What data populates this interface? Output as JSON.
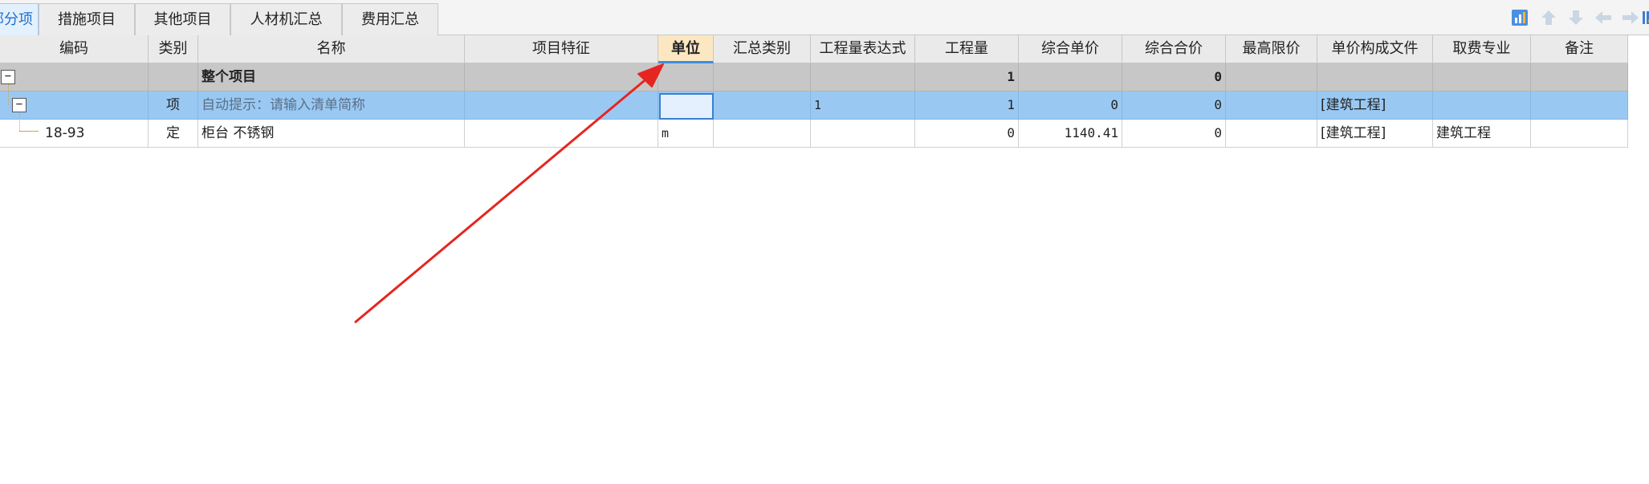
{
  "tabs": [
    {
      "label": "分部分项",
      "active": true
    },
    {
      "label": "措施项目",
      "active": false
    },
    {
      "label": "其他项目",
      "active": false
    },
    {
      "label": "人材机汇总",
      "active": false
    },
    {
      "label": "费用汇总",
      "active": false
    }
  ],
  "toolbar_icons": [
    "chart-icon",
    "arrow-up-icon",
    "arrow-down-icon",
    "arrow-left-icon",
    "arrow-right-icon",
    "settings-icon"
  ],
  "columns": [
    "编码",
    "类别",
    "名称",
    "项目特征",
    "单位",
    "汇总类别",
    "工程量表达式",
    "工程量",
    "综合单价",
    "综合合价",
    "最高限价",
    "单价构成文件",
    "取费专业",
    "备注"
  ],
  "rows": [
    {
      "code": "",
      "type": "",
      "name": "整个项目",
      "feature": "",
      "unit": "",
      "summary_type": "",
      "expression": "",
      "quantity": "1",
      "unit_price": "",
      "total_price": "0",
      "max_price": "",
      "price_file": "",
      "fee_specialty": "",
      "remark": ""
    },
    {
      "code": "",
      "type": "项",
      "name": "自动提示：请输入清单简称",
      "feature": "",
      "unit": "",
      "summary_type": "",
      "expression": "1",
      "quantity": "1",
      "unit_price": "0",
      "total_price": "0",
      "max_price": "",
      "price_file": "[建筑工程]",
      "fee_specialty": "",
      "remark": ""
    },
    {
      "code": "18-93",
      "type": "定",
      "name": "柜台 不锈钢",
      "feature": "",
      "unit": "m",
      "summary_type": "",
      "expression": "",
      "quantity": "0",
      "unit_price": "1140.41",
      "total_price": "0",
      "max_price": "",
      "price_file": "[建筑工程]",
      "fee_specialty": "建筑工程",
      "remark": ""
    }
  ],
  "colors": {
    "accent": "#3b8de0",
    "selected_row": "#99c9f3",
    "summary_row": "#c7c7c7",
    "annotation_arrow": "#e52620"
  }
}
